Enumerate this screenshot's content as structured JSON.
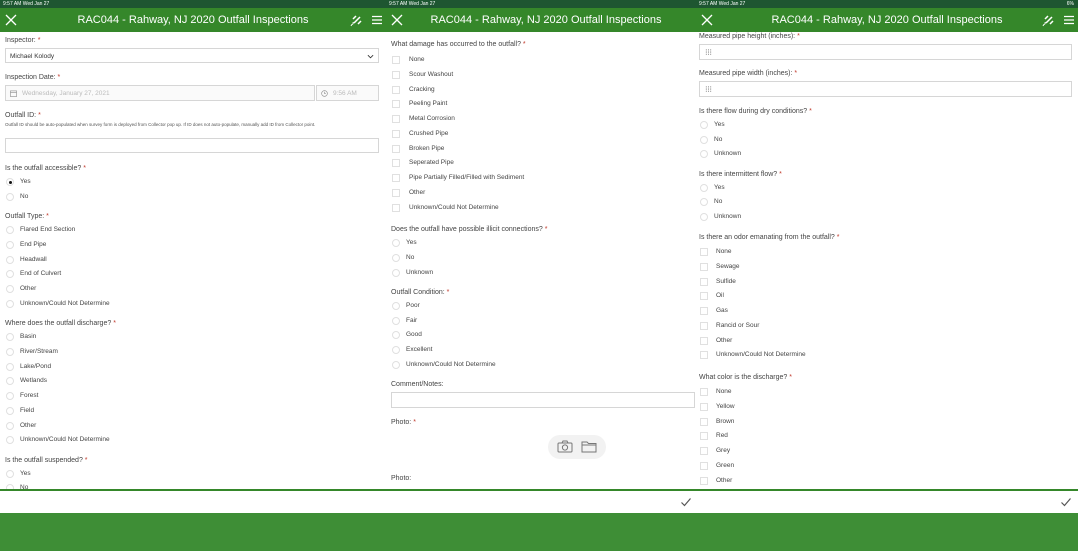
{
  "status": {
    "left1": "9:57 AM  Wed Jan 27",
    "left2": "9:57 AM  Wed Jan 27",
    "left3": "9:57 AM  Wed Jan 27",
    "right": "6%"
  },
  "app": {
    "title": "RAC044 - Rahway, NJ 2020 Outfall Inspections"
  },
  "panel1": {
    "inspector": {
      "label": "Inspector:",
      "value": "Michael Kolody"
    },
    "inspection_date": {
      "label": "Inspection Date:",
      "date": "Wednesday, January 27, 2021",
      "time": "9:56 AM"
    },
    "outfall_id": {
      "label": "Outfall ID:",
      "note": "Outfall ID should be auto-populated when survey form is deployed from Collector pop up. If ID does not auto-populate, manually add ID from Collector point."
    },
    "accessible": {
      "label": "Is the outfall accessible?",
      "options": [
        "Yes",
        "No"
      ]
    },
    "type": {
      "label": "Outfall Type:",
      "options": [
        "Flared End Section",
        "End Pipe",
        "Headwall",
        "End of Culvert",
        "Other",
        "Unknown/Could Not Determine"
      ]
    },
    "discharge": {
      "label": "Where does the outfall discharge?",
      "options": [
        "Basin",
        "River/Stream",
        "Lake/Pond",
        "Wetlands",
        "Forest",
        "Field",
        "Other",
        "Unknown/Could Not Determine"
      ]
    },
    "suspended": {
      "label": "Is the outfall suspended?",
      "options": [
        "Yes",
        "No"
      ]
    }
  },
  "panel2": {
    "damage": {
      "label": "What damage has occurred to the outfall?",
      "options": [
        "None",
        "Scour Washout",
        "Cracking",
        "Peeling Paint",
        "Metal Corrosion",
        "Crushed Pipe",
        "Broken Pipe",
        "Seperated Pipe",
        "Pipe Partially Filled/Filled with Sediment",
        "Other",
        "Unknown/Could Not Determine"
      ]
    },
    "illicit": {
      "label": "Does the outfall have possible illicit connections?",
      "options": [
        "Yes",
        "No",
        "Unknown"
      ]
    },
    "condition": {
      "label": "Outfall Condition:",
      "options": [
        "Poor",
        "Fair",
        "Good",
        "Excellent",
        "Unknown/Could Not Determine"
      ]
    },
    "comment": {
      "label": "Comment/Notes:"
    },
    "photo1": {
      "label": "Photo:"
    },
    "photo2": {
      "label": "Photo:"
    }
  },
  "panel3": {
    "height": {
      "label": "Measured pipe height (inches):"
    },
    "width": {
      "label": "Measured pipe width (inches):"
    },
    "dry_flow": {
      "label": "Is there flow during dry conditions?",
      "options": [
        "Yes",
        "No",
        "Unknown"
      ]
    },
    "intermittent": {
      "label": "Is there intermittent flow?",
      "options": [
        "Yes",
        "No",
        "Unknown"
      ]
    },
    "odor": {
      "label": "Is there an odor emanating from the outfall?",
      "options": [
        "None",
        "Sewage",
        "Sulfide",
        "Oil",
        "Gas",
        "Rancid or Sour",
        "Other",
        "Unknown/Could Not Determine"
      ]
    },
    "color": {
      "label": "What color is the discharge?",
      "options": [
        "None",
        "Yellow",
        "Brown",
        "Red",
        "Grey",
        "Green",
        "Other"
      ]
    }
  },
  "colors": {
    "appbar": "#35872a",
    "status": "#1e5631",
    "bottom": "#3e8e36",
    "required": "#c0392b"
  },
  "icons": [
    "close-icon",
    "menu-icon",
    "satellite-icon",
    "calendar-icon",
    "clock-icon",
    "chevron-down-icon",
    "camera-icon",
    "folder-icon",
    "keypad-icon",
    "checkmark-icon"
  ]
}
